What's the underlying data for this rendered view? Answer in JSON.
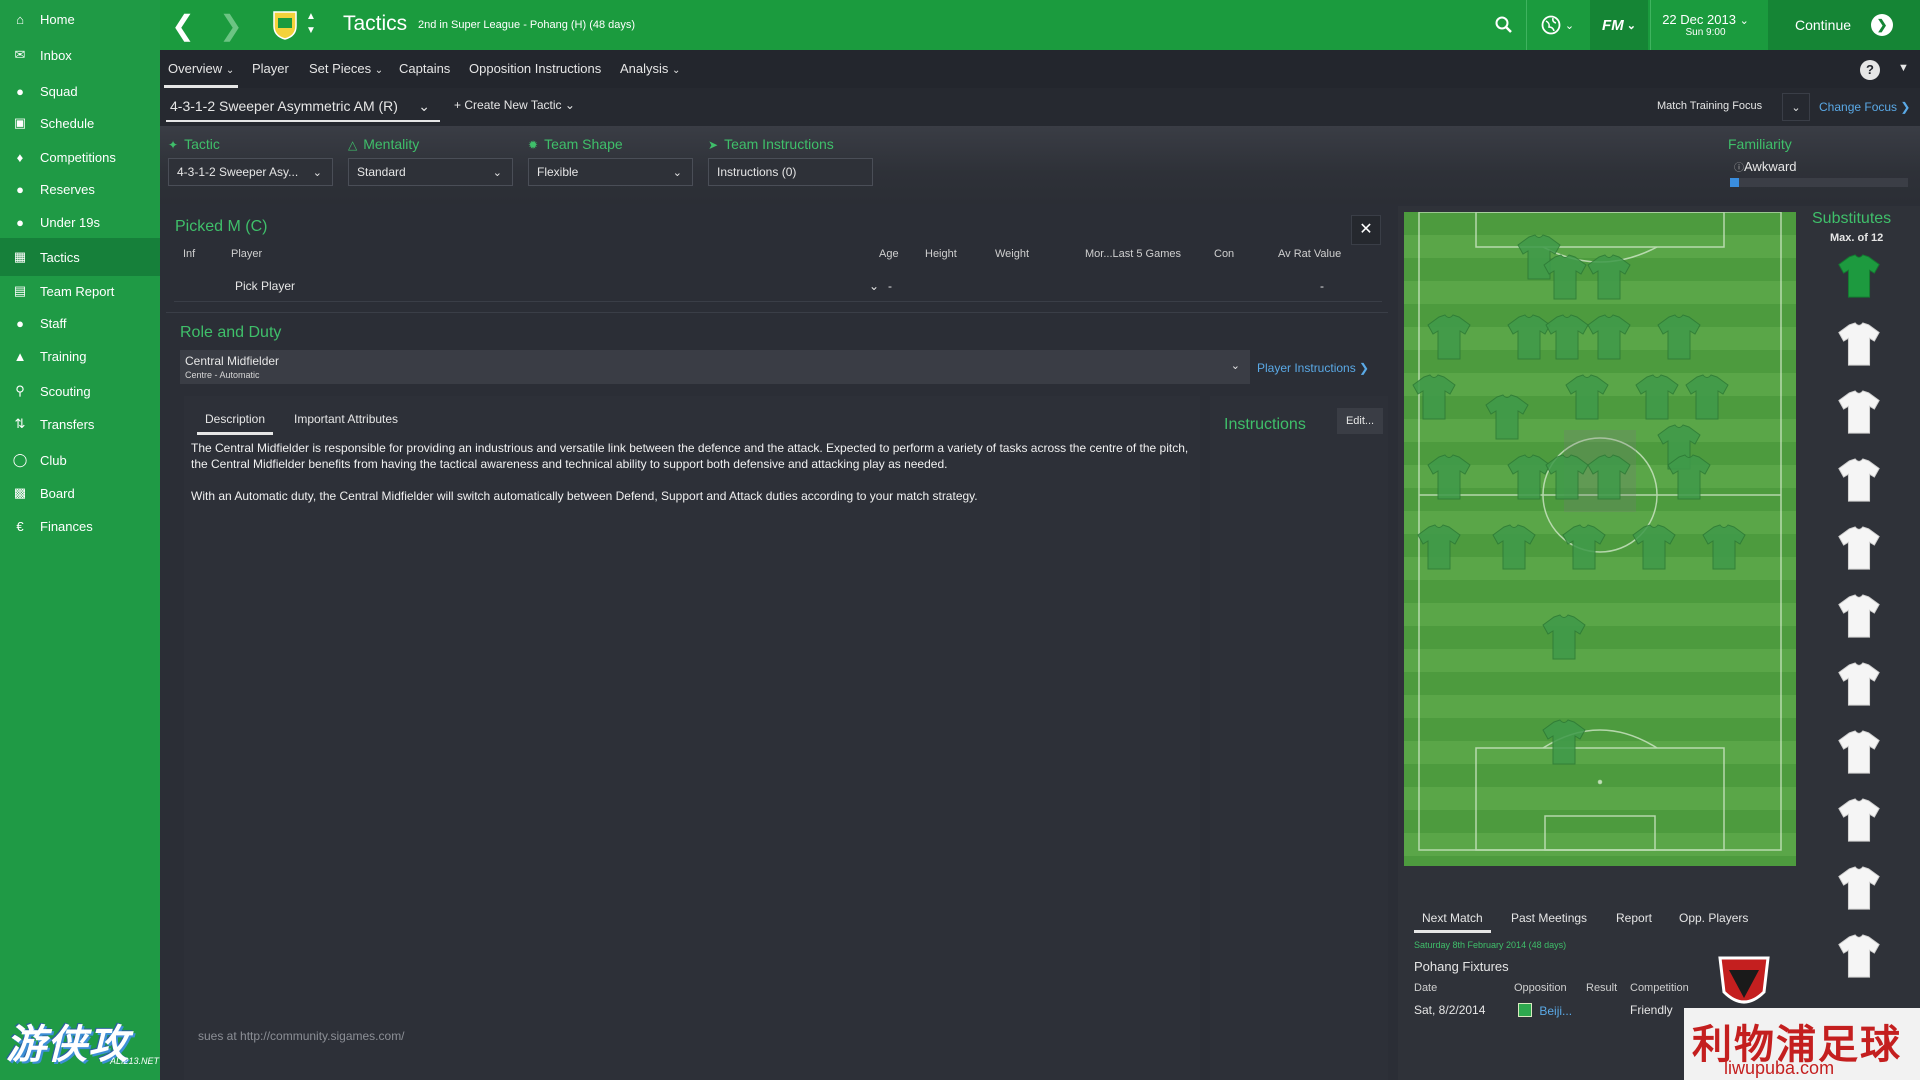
{
  "sidebar": {
    "items": [
      {
        "label": "Home",
        "icon": "home-icon"
      },
      {
        "label": "Inbox",
        "icon": "inbox-icon"
      },
      {
        "label": "Squad",
        "icon": "squad-icon"
      },
      {
        "label": "Schedule",
        "icon": "schedule-icon"
      },
      {
        "label": "Competitions",
        "icon": "trophy-icon"
      },
      {
        "label": "Reserves",
        "icon": "reserves-icon"
      },
      {
        "label": "Under 19s",
        "icon": "under19-icon"
      },
      {
        "label": "Tactics",
        "icon": "tactics-icon"
      },
      {
        "label": "Team Report",
        "icon": "report-icon"
      },
      {
        "label": "Staff",
        "icon": "staff-icon"
      },
      {
        "label": "Training",
        "icon": "training-icon"
      },
      {
        "label": "Scouting",
        "icon": "scouting-icon"
      },
      {
        "label": "Transfers",
        "icon": "transfers-icon"
      },
      {
        "label": "Club",
        "icon": "club-icon"
      },
      {
        "label": "Board",
        "icon": "board-icon"
      },
      {
        "label": "Finances",
        "icon": "finances-icon"
      }
    ],
    "active": "Tactics",
    "watermark": "游侠攻略组!",
    "watermark_sub": "ALI213.NET"
  },
  "topbar": {
    "title": "Tactics",
    "subtitle": "2nd in Super League - Pohang (H) (48 days)",
    "fm_label": "FM",
    "date": "22 Dec 2013",
    "time": "Sun 9:00",
    "continue_label": "Continue",
    "accent": "#1b9b3e"
  },
  "tabs": [
    {
      "label": "Overview",
      "has_menu": true
    },
    {
      "label": "Player",
      "has_menu": false
    },
    {
      "label": "Set Pieces",
      "has_menu": true
    },
    {
      "label": "Captains",
      "has_menu": false
    },
    {
      "label": "Opposition Instructions",
      "has_menu": false
    },
    {
      "label": "Analysis",
      "has_menu": true
    }
  ],
  "tactic_row": {
    "current_tactic": "4-3-1-2 Sweeper Asymmetric AM (R)",
    "create_new": "Create New Tactic",
    "match_training_focus": "Match Training Focus",
    "change_focus": "Change Focus"
  },
  "options": {
    "tactic": {
      "label": "Tactic",
      "value": "4-3-1-2 Sweeper Asy..."
    },
    "mentality": {
      "label": "Mentality",
      "value": "Standard"
    },
    "team_shape": {
      "label": "Team Shape",
      "value": "Flexible"
    },
    "team_instructions": {
      "label": "Team Instructions",
      "value": "Instructions (0)"
    },
    "familiarity": {
      "label": "Familiarity",
      "value": "Awkward",
      "level": 0.05
    }
  },
  "picked": {
    "title": "Picked M (C)",
    "headers": [
      "Inf",
      "Player",
      "Age",
      "Height",
      "Weight",
      "Mor...Last 5 Games",
      "Con",
      "Av Rat Value"
    ],
    "row": {
      "player": "Pick Player",
      "age": "-",
      "value": "-"
    }
  },
  "role": {
    "section_title": "Role and Duty",
    "role": "Central Midfielder",
    "duty": "Centre - Automatic",
    "player_instructions": "Player Instructions"
  },
  "description": {
    "tabs": [
      "Description",
      "Important Attributes"
    ],
    "paragraphs": [
      "The Central Midfielder is responsible for providing an industrious and versatile link between the defence and the attack. Expected to perform a variety of tasks across the centre of the pitch, the Central Midfielder benefits from having the tactical awareness and technical ability to support both defensive and attacking play as needed.",
      "With an Automatic duty, the Central Midfielder will switch automatically between Defend, Support and Attack duties according to your match strategy."
    ]
  },
  "instructions": {
    "title": "Instructions",
    "edit": "Edit..."
  },
  "footer_note": "sues at http://community.sigames.com/",
  "substitutes": {
    "title": "Substitutes",
    "max": "Max. of 12"
  },
  "next_match": {
    "tabs": [
      "Next Match",
      "Past Meetings",
      "Report",
      "Opp. Players"
    ],
    "date_line": "Saturday 8th February 2014 (48 days)",
    "title": "Pohang Fixtures",
    "headers": [
      "Date",
      "Opposition",
      "Result",
      "Competition"
    ],
    "row": {
      "date": "Sat, 8/2/2014",
      "opposition": "Beiji...",
      "result": "",
      "competition": "Friendly"
    }
  },
  "watermark2": {
    "cn": "利物浦足球网",
    "url": "liwupuba.com"
  }
}
